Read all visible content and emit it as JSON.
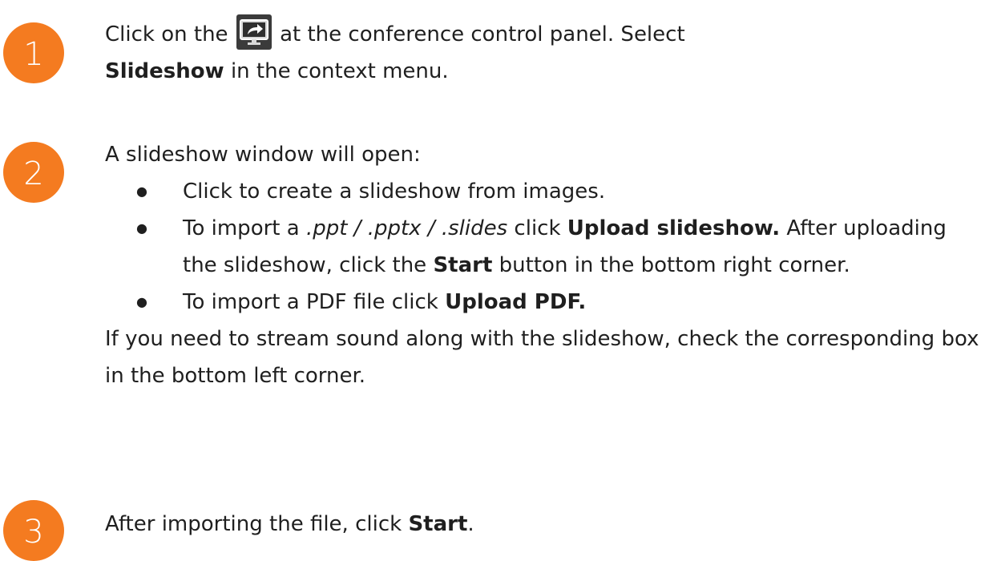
{
  "steps": [
    {
      "number": "1",
      "text_before_icon": "Click on the",
      "icon": "share-screen-icon",
      "text_after_icon": "at the conference control panel. Select",
      "bold": "Slideshow",
      "text_end": "in the context menu."
    },
    {
      "number": "2",
      "intro": "A slideshow window will open:",
      "bullets": [
        {
          "text": "Click to create a slideshow from images."
        },
        {
          "prefix": "To import a",
          "formats": ".ppt / .pptx / .slides",
          "mid": "click",
          "bold": "Upload slideshow.",
          "after": "After uploading the slideshow, click the",
          "bold2": "Start",
          "end": "button in the bottom right corner."
        },
        {
          "prefix": "To import a PDF file click",
          "bold": "Upload PDF."
        }
      ],
      "note": "If you need to stream sound along with the slideshow, check the corresponding box in the bottom left corner."
    },
    {
      "number": "3",
      "text": "After importing the file, click",
      "bold": "Start",
      "end": "."
    }
  ],
  "colors": {
    "badge": "#f47b20",
    "icon_bg": "#3b3b3b",
    "text": "#1f1f1f"
  },
  "bullet_glyph": "●"
}
